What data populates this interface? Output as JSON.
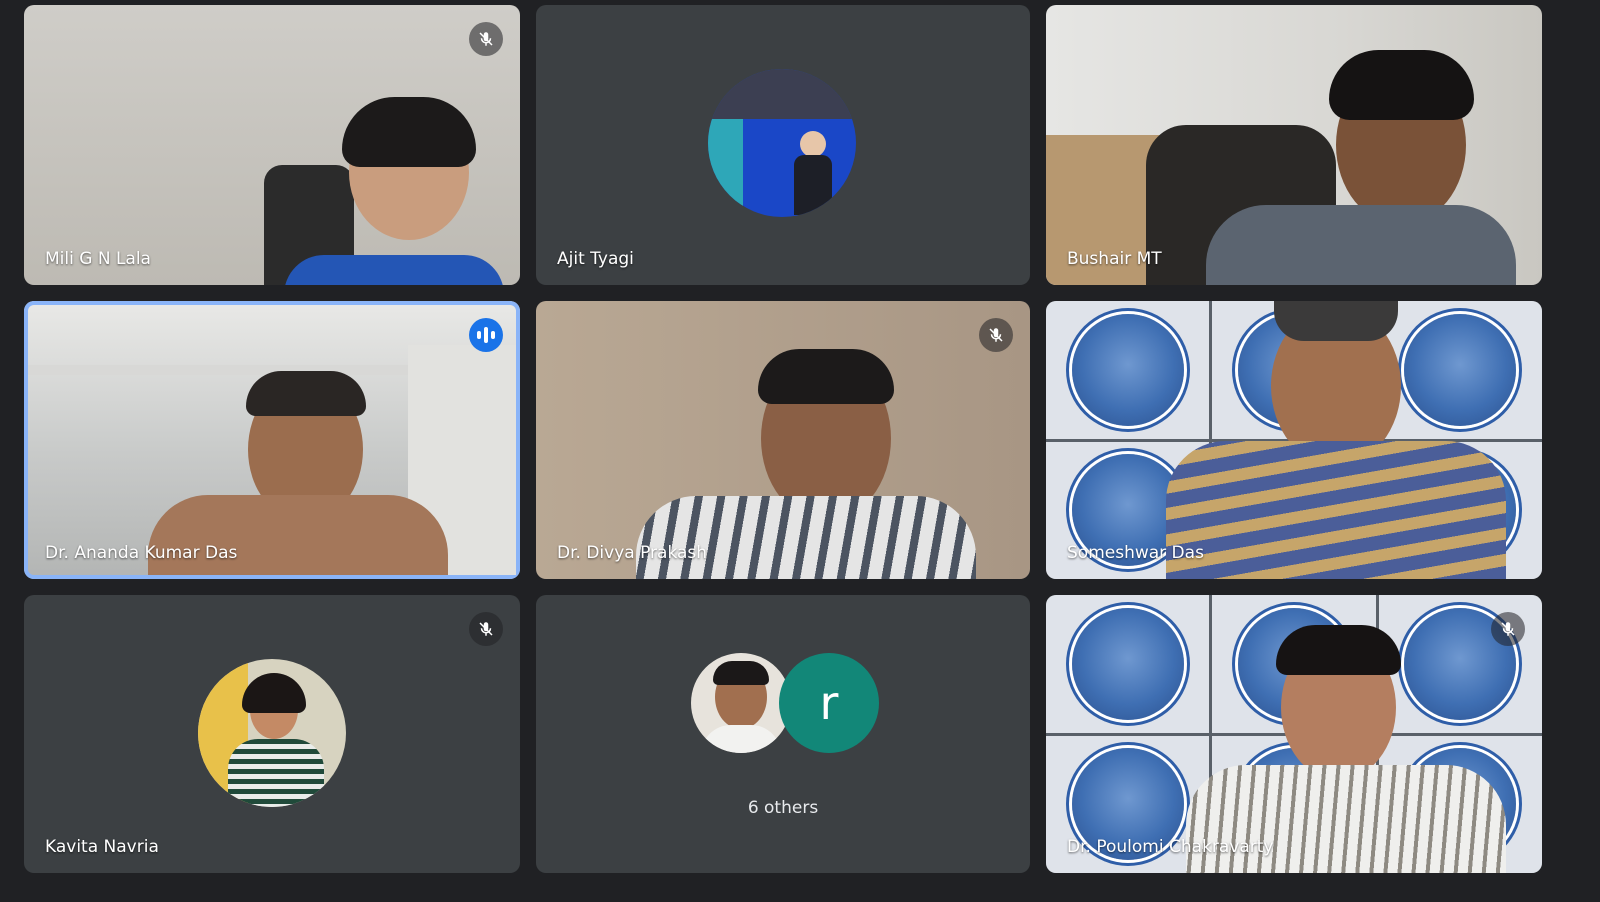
{
  "participants": [
    {
      "name": "Mili G N Lala",
      "muted": true
    },
    {
      "name": "Ajit Tyagi",
      "muted": false
    },
    {
      "name": "Bushair MT",
      "muted": false
    },
    {
      "name": "Dr. Ananda Kumar Das",
      "speaking": true
    },
    {
      "name": "Dr. Divya Prakash",
      "muted": true
    },
    {
      "name": "Someshwar Das",
      "muted": false
    },
    {
      "name": "Kavita Navria",
      "muted": true
    },
    {
      "name": "Dr. Poulomi Chakravarty",
      "muted": true
    }
  ],
  "others": {
    "label": "6 others",
    "avatar_letter": "r",
    "avatar_color": "#128778"
  },
  "colors": {
    "background": "#202124",
    "tile": "#3c4043",
    "active_border": "#8ab4f8",
    "speaking_badge": "#1a73e8"
  }
}
